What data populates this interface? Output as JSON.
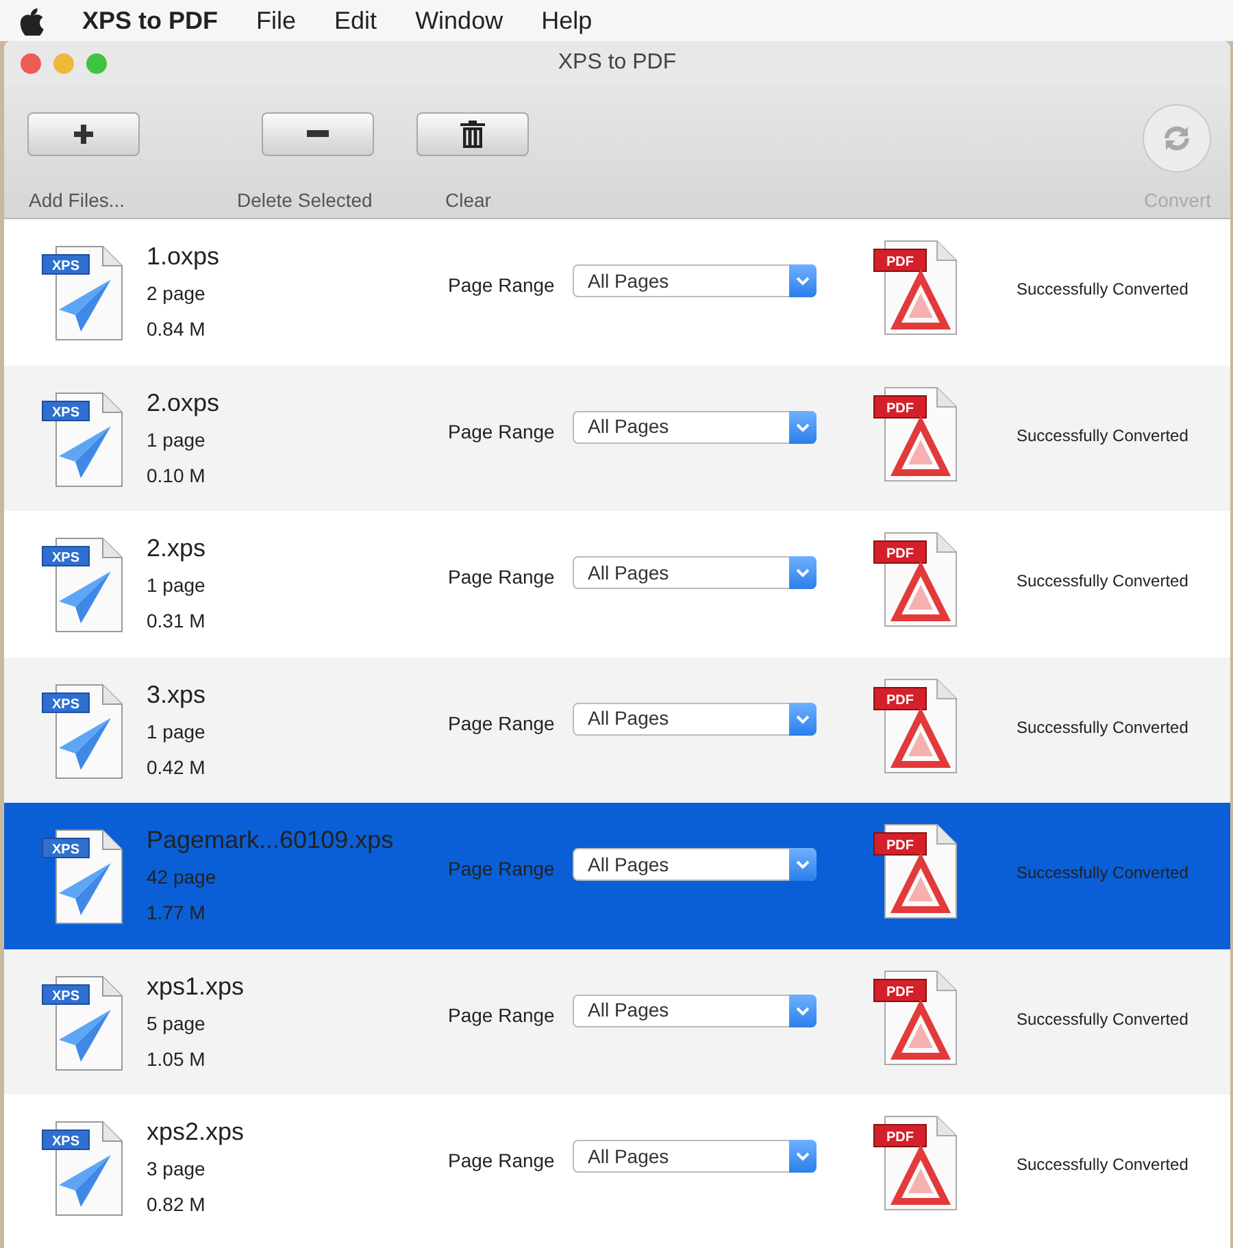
{
  "menu_bar": {
    "app_name": "XPS to PDF",
    "items": [
      "File",
      "Edit",
      "Window",
      "Help"
    ]
  },
  "window": {
    "title": "XPS to PDF"
  },
  "toolbar": [
    {
      "kind": "add",
      "label": "Add Files...",
      "disabled": false
    },
    {
      "kind": "delete",
      "label": "Delete Selected",
      "disabled": false
    },
    {
      "kind": "clear",
      "label": "Clear",
      "disabled": false
    },
    {
      "kind": "convert",
      "label": "Convert",
      "disabled": true
    }
  ],
  "files": [
    {
      "name": "1.oxps",
      "pages": "2 page",
      "size": "0.84 M",
      "range_label": "Page Range",
      "range": "All Pages",
      "xps_badge": "XPS",
      "pdf_badge": "PDF",
      "status": "Successfully Converted",
      "selected": false
    },
    {
      "name": "2.oxps",
      "pages": "1 page",
      "size": "0.10 M",
      "range_label": "Page Range",
      "range": "All Pages",
      "xps_badge": "XPS",
      "pdf_badge": "PDF",
      "status": "Successfully Converted",
      "selected": false
    },
    {
      "name": "2.xps",
      "pages": "1 page",
      "size": "0.31 M",
      "range_label": "Page Range",
      "range": "All Pages",
      "xps_badge": "XPS",
      "pdf_badge": "PDF",
      "status": "Successfully Converted",
      "selected": false
    },
    {
      "name": "3.xps",
      "pages": "1 page",
      "size": "0.42 M",
      "range_label": "Page Range",
      "range": "All Pages",
      "xps_badge": "XPS",
      "pdf_badge": "PDF",
      "status": "Successfully Converted",
      "selected": false
    },
    {
      "name": "Pagemark...60109.xps",
      "pages": "42 page",
      "size": "1.77 M",
      "range_label": "Page Range",
      "range": "All Pages",
      "xps_badge": "XPS",
      "pdf_badge": "PDF",
      "status": "Successfully Converted",
      "selected": true
    },
    {
      "name": "xps1.xps",
      "pages": "5 page",
      "size": "1.05 M",
      "range_label": "Page Range",
      "range": "All Pages",
      "xps_badge": "XPS",
      "pdf_badge": "PDF",
      "status": "Successfully Converted",
      "selected": false
    },
    {
      "name": "xps2.xps",
      "pages": "3 page",
      "size": "0.82 M",
      "range_label": "Page Range",
      "range": "All Pages",
      "xps_badge": "XPS",
      "pdf_badge": "PDF",
      "status": "Successfully Converted",
      "selected": false
    }
  ]
}
